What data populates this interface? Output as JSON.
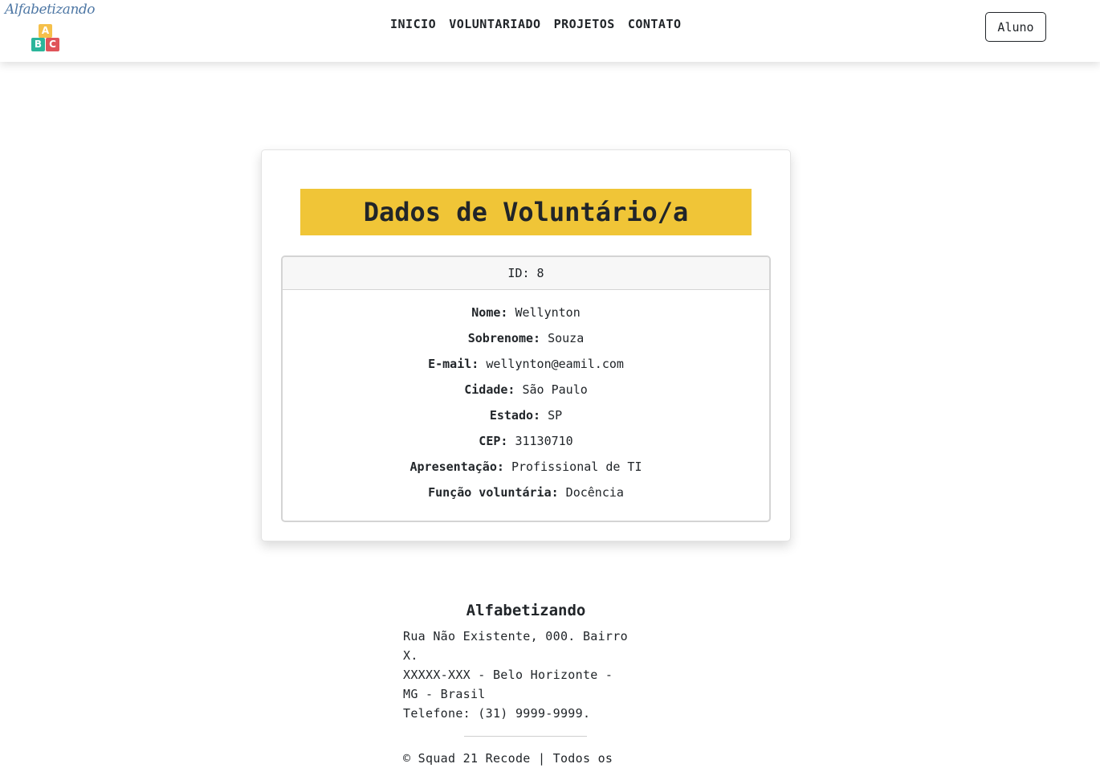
{
  "brand": {
    "name": "Alfabetizando",
    "blocks": [
      {
        "letter": "A",
        "color": "#f5c04a"
      },
      {
        "letter": "B",
        "color": "#2bb59a"
      },
      {
        "letter": "C",
        "color": "#e0545a"
      }
    ]
  },
  "nav": {
    "items": [
      "INICIO",
      "VOLUNTARIADO",
      "PROJETOS",
      "CONTATO"
    ],
    "login_label": "Aluno"
  },
  "card": {
    "title": "Dados de Voluntário/a",
    "id_text": "ID: 8",
    "fields": [
      {
        "label": "Nome:",
        "value": "Wellynton"
      },
      {
        "label": "Sobrenome:",
        "value": "Souza"
      },
      {
        "label": "E-mail:",
        "value": "wellynton@eamil.com"
      },
      {
        "label": "Cidade:",
        "value": "São Paulo"
      },
      {
        "label": "Estado:",
        "value": "SP"
      },
      {
        "label": "CEP:",
        "value": "31130710"
      },
      {
        "label": "Apresentação:",
        "value": "Profissional de TI"
      },
      {
        "label": "Função voluntária:",
        "value": "Docência"
      }
    ]
  },
  "footer": {
    "title": "Alfabetizando",
    "address": "Rua Não Existente, 000. Bairro\nX.\nXXXXX-XXX - Belo Horizonte -\nMG - Brasil\nTelefone: (31) 9999-9999.",
    "copyright": "© Squad 21 Recode | Todos os"
  },
  "colors": {
    "accent_yellow": "#f0c537",
    "logo_blue": "#4f78a5"
  }
}
